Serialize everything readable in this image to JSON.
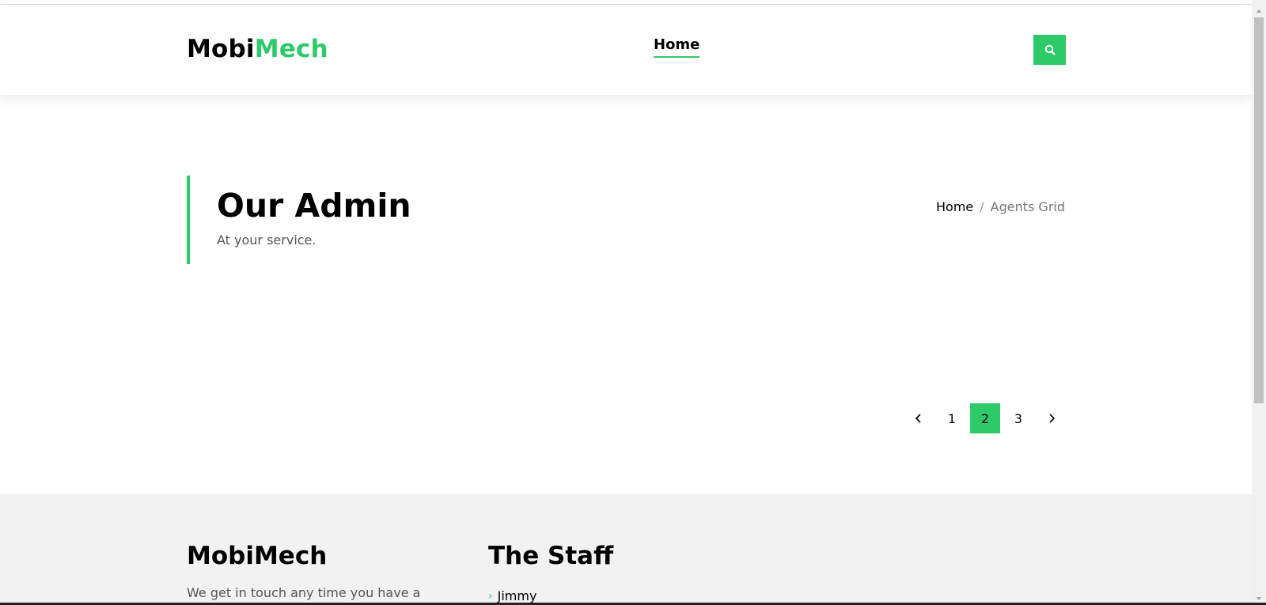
{
  "header": {
    "logo_part1": "Mobi",
    "logo_part2": "Mech",
    "nav_home": "Home",
    "search_icon": "search-icon"
  },
  "hero": {
    "title": "Our Admin",
    "subtitle": "At your service.",
    "breadcrumb": {
      "home": "Home",
      "separator": "/",
      "current": "Agents Grid"
    }
  },
  "pagination": {
    "pages": [
      "1",
      "2",
      "3"
    ],
    "active": "2",
    "prev_icon": "chevron-left-icon",
    "next_icon": "chevron-right-icon"
  },
  "footer": {
    "brand": "MobiMech",
    "description": "We get in touch any time you have a",
    "staff_title": "The Staff",
    "staff_items": [
      "Jimmy"
    ]
  },
  "colors": {
    "accent": "#2eca6a",
    "footer_bg": "#f2f2f2"
  }
}
